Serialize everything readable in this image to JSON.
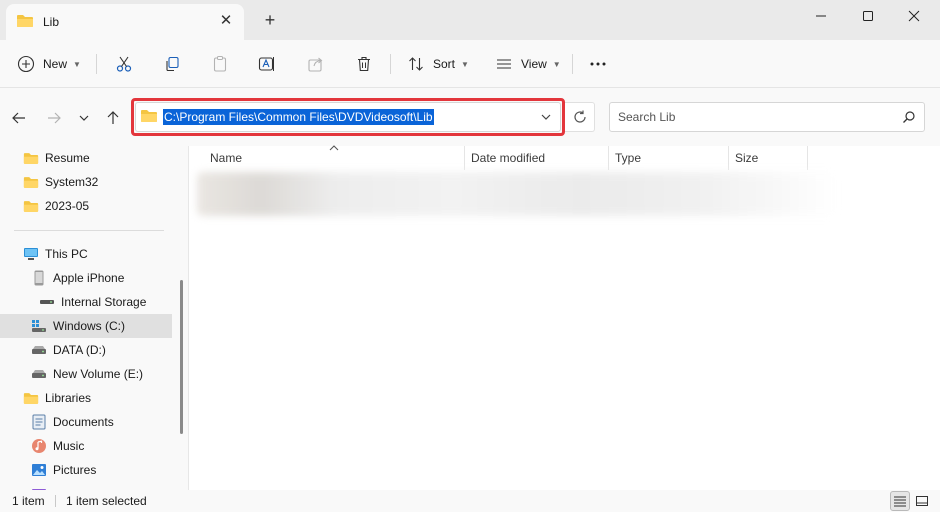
{
  "tab": {
    "title": "Lib"
  },
  "toolbar": {
    "new_label": "New",
    "sort_label": "Sort",
    "view_label": "View"
  },
  "address": {
    "path": "C:\\Program Files\\Common Files\\DVDVideosoft\\Lib"
  },
  "search": {
    "placeholder": "Search Lib"
  },
  "sidebar": {
    "items": [
      {
        "label": "Resume",
        "icon": "folder-icon"
      },
      {
        "label": "System32",
        "icon": "folder-icon"
      },
      {
        "label": "2023-05",
        "icon": "folder-icon"
      },
      {
        "label": "This PC",
        "icon": "computer-icon"
      },
      {
        "label": "Apple iPhone",
        "icon": "phone-icon"
      },
      {
        "label": "Internal Storage",
        "icon": "storage-icon"
      },
      {
        "label": "Windows (C:)",
        "icon": "windows-drive-icon"
      },
      {
        "label": "DATA (D:)",
        "icon": "drive-icon"
      },
      {
        "label": "New Volume (E:)",
        "icon": "drive-icon"
      },
      {
        "label": "Libraries",
        "icon": "folder-icon"
      },
      {
        "label": "Documents",
        "icon": "documents-icon"
      },
      {
        "label": "Music",
        "icon": "music-icon"
      },
      {
        "label": "Pictures",
        "icon": "pictures-icon"
      }
    ]
  },
  "columns": {
    "name": "Name",
    "date_modified": "Date modified",
    "type": "Type",
    "size": "Size"
  },
  "status": {
    "count": "1 item",
    "selected": "1 item selected"
  },
  "colors": {
    "accent": "#0a64d8",
    "highlight_frame": "#e3363c",
    "folder": "#f4c542"
  }
}
